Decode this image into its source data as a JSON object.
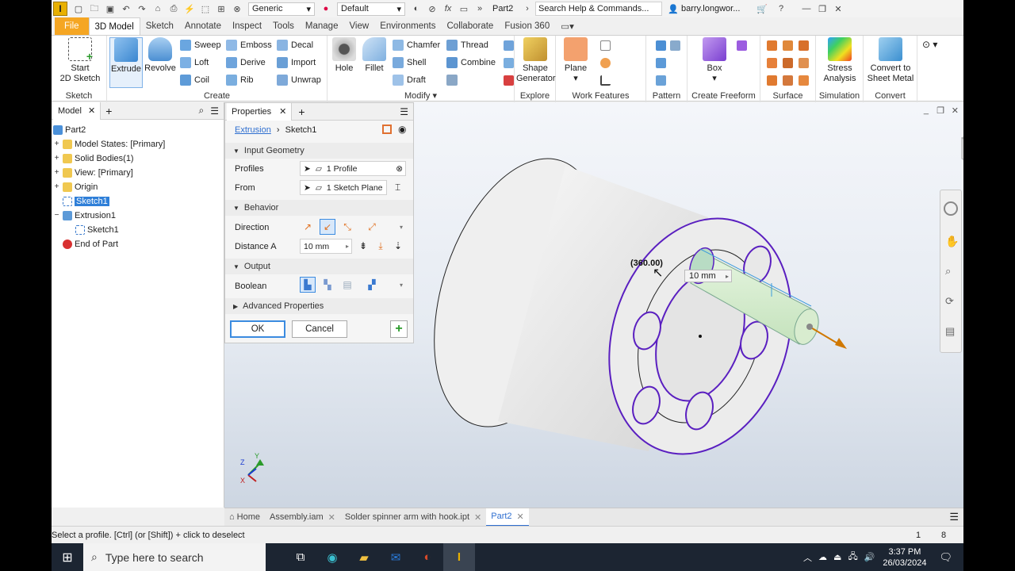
{
  "qat": {
    "style": "Generic",
    "appearance": "Default",
    "doc_title": "Part2",
    "search": "Search Help & Commands...",
    "user": "barry.longwor..."
  },
  "tabs": [
    "File",
    "3D Model",
    "Sketch",
    "Annotate",
    "Inspect",
    "Tools",
    "Manage",
    "View",
    "Environments",
    "Collaborate",
    "Fusion 360"
  ],
  "ribbon": {
    "sketch": {
      "start": "Start\n2D Sketch",
      "title": "Sketch"
    },
    "create": {
      "extrude": "Extrude",
      "revolve": "Revolve",
      "sweep": "Sweep",
      "loft": "Loft",
      "coil": "Coil",
      "emboss": "Emboss",
      "derive": "Derive",
      "rib": "Rib",
      "decal": "Decal",
      "import": "Import",
      "unwrap": "Unwrap",
      "title": "Create"
    },
    "modify": {
      "hole": "Hole",
      "fillet": "Fillet",
      "chamfer": "Chamfer",
      "shell": "Shell",
      "draft": "Draft",
      "thread": "Thread",
      "combine": "Combine",
      "title": "Modify"
    },
    "explore": {
      "shape": "Shape\nGenerator",
      "title": "Explore"
    },
    "work": {
      "plane": "Plane",
      "title": "Work Features"
    },
    "pattern": {
      "title": "Pattern"
    },
    "freeform": {
      "box": "Box",
      "title": "Create Freeform"
    },
    "surface": {
      "title": "Surface"
    },
    "simulation": {
      "stress": "Stress\nAnalysis",
      "title": "Simulation"
    },
    "convert": {
      "sheet": "Convert to\nSheet Metal",
      "title": "Convert"
    }
  },
  "browser": {
    "tab": "Model",
    "items": [
      "Part2",
      "Model States: [Primary]",
      "Solid Bodies(1)",
      "View: [Primary]",
      "Origin",
      "Sketch1",
      "Extrusion1",
      "Sketch1",
      "End of Part"
    ]
  },
  "props": {
    "tab": "Properties",
    "feature": "Extrusion",
    "sketch": "Sketch1",
    "sec_input": "Input Geometry",
    "profiles_lbl": "Profiles",
    "profiles_val": "1 Profile",
    "from_lbl": "From",
    "from_val": "1 Sketch Plane",
    "sec_behavior": "Behavior",
    "direction_lbl": "Direction",
    "distance_lbl": "Distance A",
    "distance_val": "10 mm",
    "sec_output": "Output",
    "boolean_lbl": "Boolean",
    "advanced": "Advanced Properties",
    "ok": "OK",
    "cancel": "Cancel"
  },
  "viewport": {
    "angle": "(360.00)",
    "dim": "10 mm"
  },
  "doctabs": [
    "Home",
    "Assembly.iam",
    "Solder spinner arm with hook.ipt",
    "Part2"
  ],
  "status": {
    "msg": "Select a profile. [Ctrl] (or [Shift]) + click to deselect",
    "n1": "1",
    "n2": "8"
  },
  "taskbar": {
    "search": "Type here to search",
    "time": "3:37 PM",
    "date": "26/03/2024"
  }
}
